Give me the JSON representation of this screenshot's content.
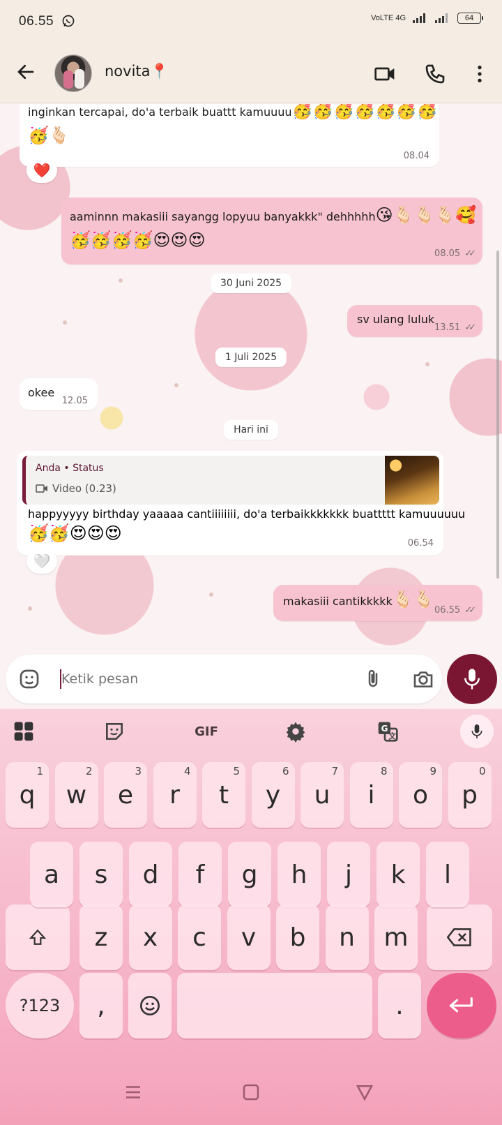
{
  "status_bar": {
    "time": "06.55",
    "network": "VoLTE 4G",
    "battery": "64"
  },
  "header": {
    "contact_name": "novita📍"
  },
  "messages": [
    {
      "text": "inginkan tercapai, do'a terbaik buattt kamuuuu",
      "emoji_line1": "🥳🥳🥳🥳🥳🥳🥳",
      "emoji_line2": "🥳🫰🏻",
      "time": "08.04",
      "reaction": "❤️"
    },
    {
      "text": "aaminnn makasiii sayangg lopyuu banyakkk\" dehhhhh",
      "emoji_line1": "😘🫰🏻🫰🏻🫰🏻🥰",
      "emoji_line2": "🥳🥳🥳🥳😍😍😍",
      "time": "08.05"
    },
    {
      "text": "sv ulang luluk",
      "time": "13.51"
    },
    {
      "text": "okee",
      "time": "12.05"
    },
    {
      "quote_who": "Anda • Status",
      "quote_what": "Video (0.23)",
      "text": "happyyyyy birthday yaaaaa cantiiiiiiii, do'a terbaikkkkkkk buattttt kamuuuuuu",
      "emoji_line1": "🥳🥳😍😍😍",
      "time": "06.54",
      "reaction": "🤍"
    },
    {
      "text": "makasiii cantikkkkk",
      "emoji_line1": "🫰🏻🫰🏻",
      "time": "06.55"
    }
  ],
  "dates": {
    "d1": "30 Juni 2025",
    "d2": "1 Juli 2025",
    "d3": "Hari ini"
  },
  "input": {
    "placeholder": "Ketik pesan"
  },
  "keyboard": {
    "gif_label": "GIF",
    "row1": [
      "q",
      "w",
      "e",
      "r",
      "t",
      "y",
      "u",
      "i",
      "o",
      "p"
    ],
    "row1_hints": [
      "1",
      "2",
      "3",
      "4",
      "5",
      "6",
      "7",
      "8",
      "9",
      "0"
    ],
    "row2": [
      "a",
      "s",
      "d",
      "f",
      "g",
      "h",
      "j",
      "k",
      "l"
    ],
    "row3": [
      "z",
      "x",
      "c",
      "v",
      "b",
      "n",
      "m"
    ],
    "symbols_label": "?123",
    "comma": ",",
    "period": "."
  },
  "colors": {
    "accent": "#7a1631",
    "outgoing_bubble": "#f7c3d0",
    "enter_key": "#ec5d8c"
  }
}
